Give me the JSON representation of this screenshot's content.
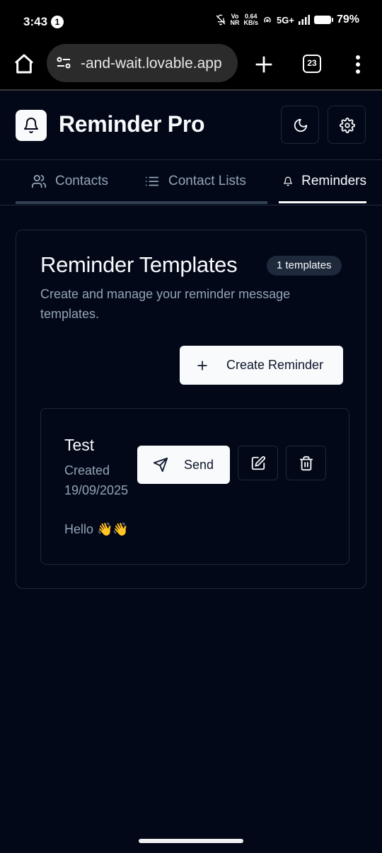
{
  "status_bar": {
    "time": "3:43",
    "notification_count": "1",
    "volte_top": "Vo",
    "volte_bottom": "NR",
    "speed_value": "0.64",
    "speed_unit": "KB/s",
    "network": "5G+",
    "battery": "79%"
  },
  "browser": {
    "url": "-and-wait.lovable.app",
    "tab_count": "23"
  },
  "app": {
    "title": "Reminder Pro"
  },
  "tabs": [
    {
      "label": "Contacts",
      "icon": "users-icon"
    },
    {
      "label": "Contact Lists",
      "icon": "list-icon"
    },
    {
      "label": "Reminders",
      "icon": "bell-icon",
      "active": true
    }
  ],
  "reminders": {
    "title": "Reminder Templates",
    "count_badge": "1 templates",
    "description": "Create and manage your reminder message templates.",
    "create_label": "Create Reminder",
    "templates": [
      {
        "name": "Test",
        "created": "Created 19/09/2025",
        "message": "Hello 👋👋",
        "send_label": "Send"
      }
    ]
  },
  "colors": {
    "background": "#020817",
    "border": "#1e293b",
    "muted_text": "#94a3b8",
    "primary": "#f8fafc"
  }
}
